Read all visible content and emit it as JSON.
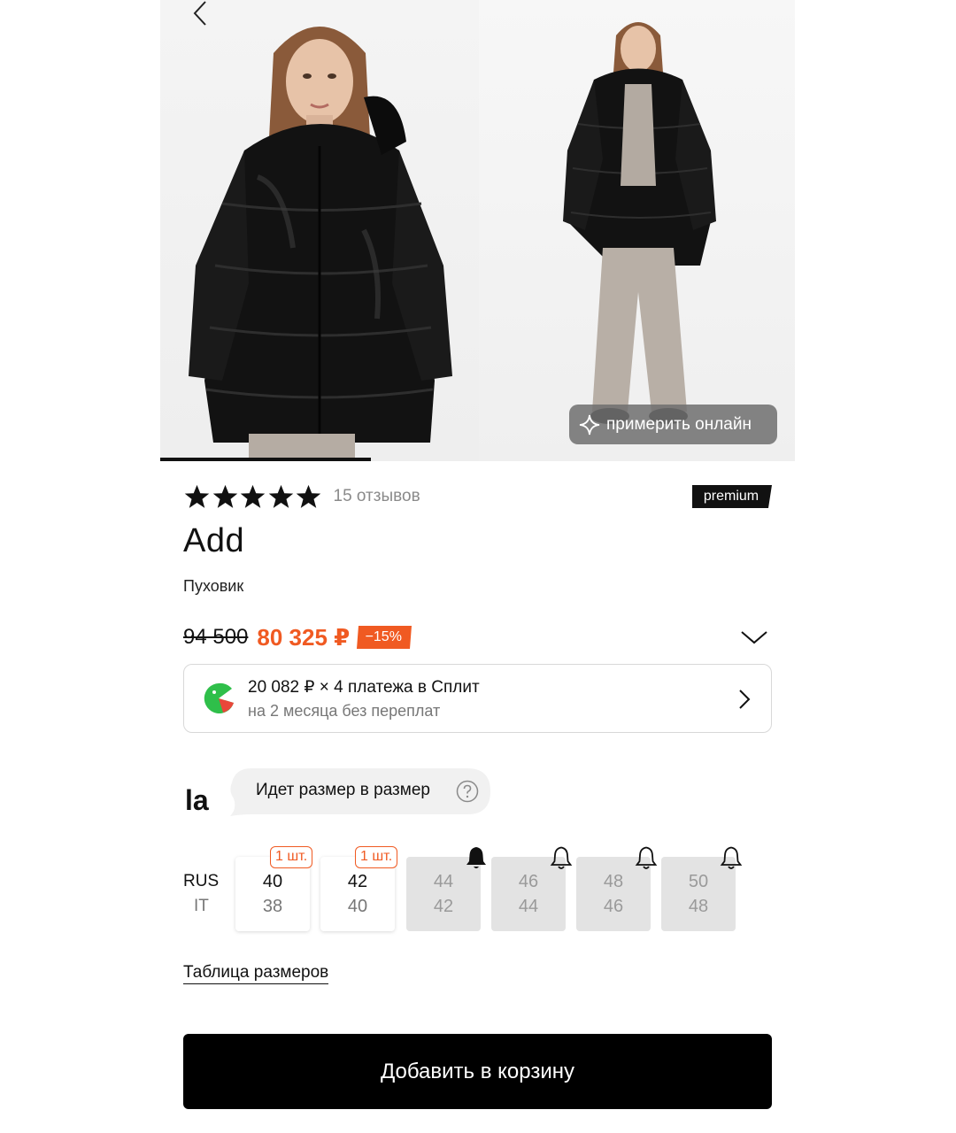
{
  "gallery": {
    "photos": [
      "product-photo-front",
      "product-photo-full"
    ],
    "try_on_label": "примерить онлайн",
    "progress": 0.33
  },
  "product": {
    "rating": 5,
    "reviews_label": "15 отзывов",
    "badge": "premium",
    "brand": "Add",
    "type": "Пуховик"
  },
  "price": {
    "old": "94 500",
    "current": "80 325 ₽",
    "discount": "−15%"
  },
  "split": {
    "main": "20 082 ₽ × 4 платежа в Сплит",
    "sub": "на 2 месяца без переплат"
  },
  "fit": {
    "brand_logo": "la",
    "text": "Идет размер в размер"
  },
  "sizes": {
    "row_labels": {
      "rus": "RUS",
      "it": "IT"
    },
    "items": [
      {
        "rus": "40",
        "it": "38",
        "available": true,
        "stock": "1 шт."
      },
      {
        "rus": "42",
        "it": "40",
        "available": true,
        "stock": "1 шт."
      },
      {
        "rus": "44",
        "it": "42",
        "available": false,
        "bell": "bell-filled-icon"
      },
      {
        "rus": "46",
        "it": "44",
        "available": false,
        "bell": "bell-icon"
      },
      {
        "rus": "48",
        "it": "46",
        "available": false,
        "bell": "bell-icon"
      },
      {
        "rus": "50",
        "it": "48",
        "available": false,
        "bell": "bell-icon"
      }
    ],
    "table_link": "Таблица размеров"
  },
  "cart": {
    "label": "Добавить в корзину"
  },
  "colors": {
    "accent": "#f05a22",
    "button": "#000000",
    "premium_bg": "#111111"
  }
}
